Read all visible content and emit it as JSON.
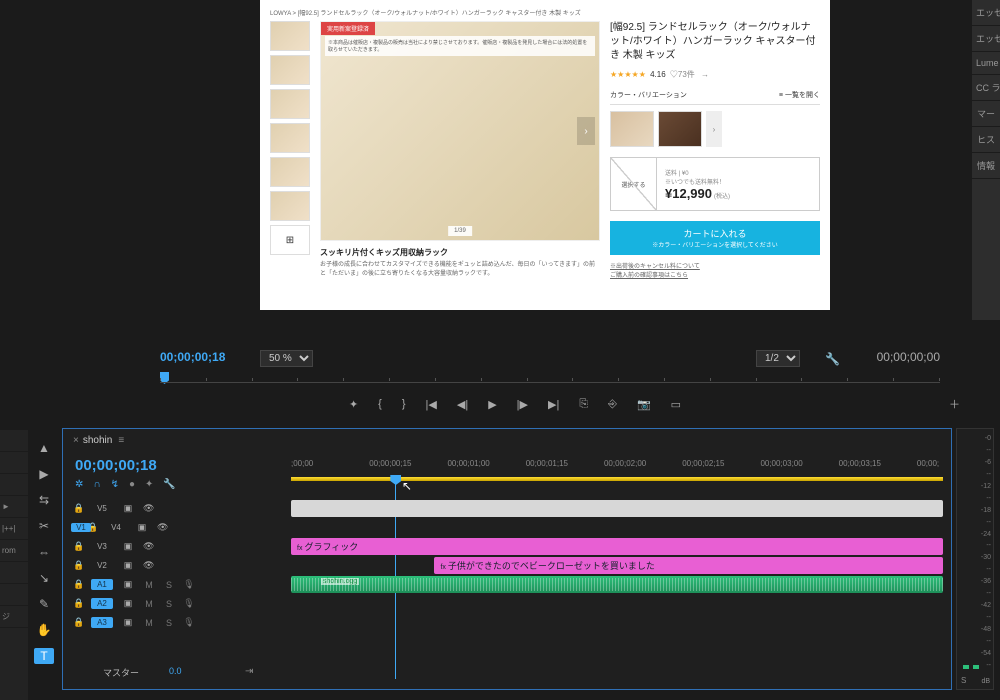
{
  "right_dock": [
    "エッセ",
    "エッセ",
    "Lume",
    "CC ラ",
    "マー",
    "ヒス",
    "情報"
  ],
  "preview": {
    "breadcrumb": "LOWYA > [幅92.5] ランドセルラック（オーク/ウォルナット/ホワイト）ハンガーラック キャスター付き 木製 キッズ",
    "badge": "実用新案登録済",
    "note_top": "※本商品は催販店・複製品の販売は当社により禁じさせております。催販店・複製品を発見した場合には法的処置を取らせていただきます。",
    "pager": "1/39",
    "caption": "スッキリ片付くキッズ用収納ラック",
    "caption_sub": "お子様の成長に合わせてカスタマイズできる機能をギュッと詰め込んだ、毎日の「いってきます」の前と「ただいま」の後に立ち寄りたくなる大容量収納ラックです。",
    "title": "[幅92.5] ランドセルラック（オーク/ウォルナット/ホワイト）ハンガーラック キャスター付き 木製 キッズ",
    "rating_num": "4.16",
    "rating_count": "♡73件",
    "variation_h": "カラー・バリエーション",
    "variation_link": "一覧を開く",
    "select_box": "選択する",
    "ship1": "送料 | ¥0",
    "ship2": "※いつでも送料無料！",
    "price": "¥12,990",
    "tax": "(税込)",
    "cart_big": "カートに入れる",
    "cart_small": "※カラー・バリエーションを選択してください",
    "note1": "※出荷後のキャンセル料について",
    "note2": "ご購入前の確認事項はこちら"
  },
  "monitor": {
    "tc": "00;00;00;18",
    "zoom": "50 %",
    "res": "1/2",
    "tc2": "00;00;00;00"
  },
  "play_btns": [
    "✦",
    "{",
    "}",
    "|◀",
    "◀|",
    "▶",
    "|▶",
    "▶|",
    "⎘",
    "⎆",
    "📷",
    "▭"
  ],
  "tools": [
    "▲",
    "▶",
    "⇆",
    "✂",
    "⇔",
    "↘",
    "✎",
    "✋",
    "T"
  ],
  "proj_rows": [
    "",
    "",
    "",
    "►",
    "|++|",
    "rom",
    "",
    "",
    "ジ",
    ""
  ],
  "timeline": {
    "tab": "shohin",
    "tc": "00;00;00;18",
    "ruler": [
      ";00;00",
      "00;00;00;15",
      "00;00;01;00",
      "00;00;01;15",
      "00;00;02;00",
      "00;00;02;15",
      "00;00;03;00",
      "00;00;03;15",
      "00;00;"
    ],
    "playhead_pct": 16,
    "tracks_v": [
      "V5",
      "V4",
      "V3",
      "V2"
    ],
    "tracks_a": [
      "A1",
      "A2",
      "A3"
    ],
    "master": "マスター",
    "master_val": "0.0",
    "clip_v3": "グラフィック",
    "clip_v2": "子供ができたのでベビークローゼットを買いました",
    "clip_a_label": "shohin.ogg"
  },
  "meter": {
    "ticks": [
      "-0",
      "--",
      "-6",
      "--",
      "-12",
      "--",
      "-18",
      "--",
      "-24",
      "--",
      "-30",
      "--",
      "-36",
      "--",
      "-42",
      "--",
      "-48",
      "--",
      "-54",
      "--"
    ],
    "s": "S",
    "db": "dB"
  }
}
